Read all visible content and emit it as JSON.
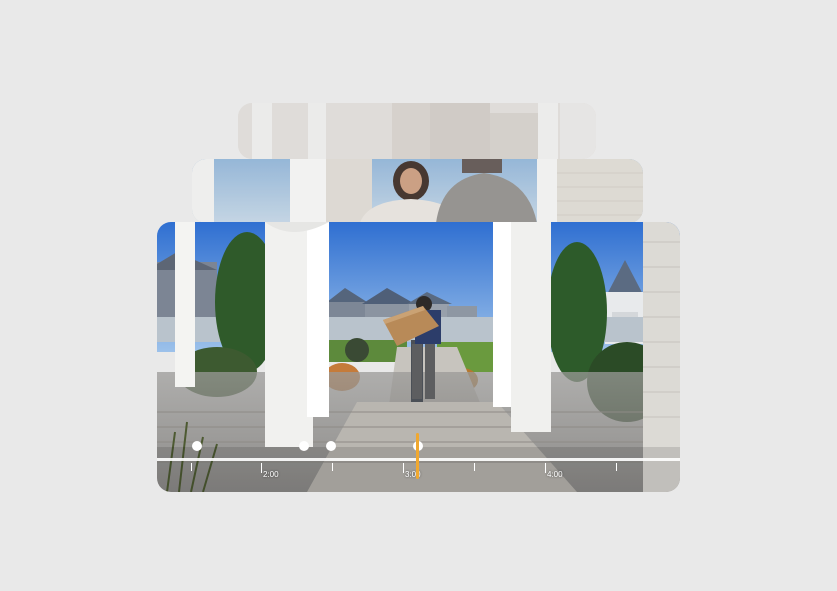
{
  "timeline": {
    "labels": [
      "2:00",
      "3:00",
      "4:00"
    ],
    "playhead_color": "#f0a830",
    "event_markers": 4
  },
  "icons": [
    "event-dot-icon",
    "playhead-icon"
  ]
}
